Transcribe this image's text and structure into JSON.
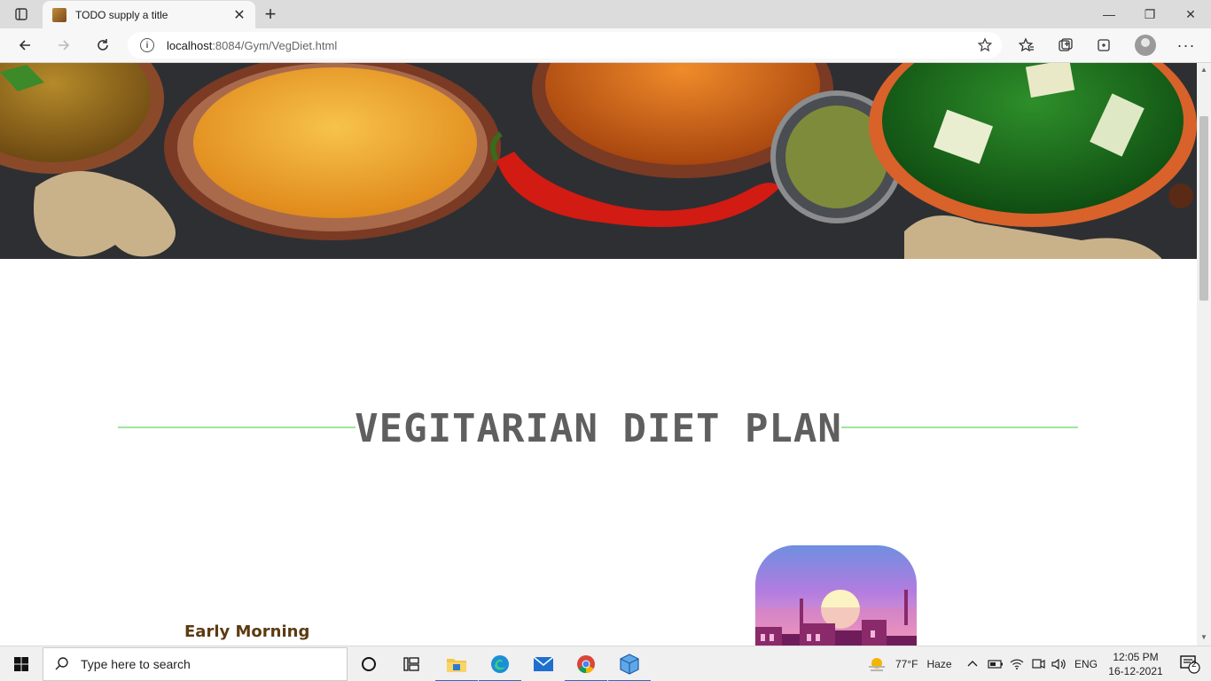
{
  "browser": {
    "tab_title": "TODO supply a title",
    "tab_close_glyph": "✕",
    "new_tab_glyph": "+",
    "url_host": "localhost",
    "url_rest": ":8084/Gym/VegDiet.html",
    "window_minimize": "—",
    "window_restore": "❐",
    "window_close": "✕"
  },
  "page": {
    "heading": "VEGITARIAN DIET PLAN",
    "section_label": "Early Morning",
    "colors": {
      "heading_text": "#5f5f5f",
      "heading_rule": "#9be69b",
      "section_label": "#5c3b12"
    }
  },
  "taskbar": {
    "search_placeholder": "Type here to search",
    "weather_temp": "77°F",
    "weather_condition": "Haze",
    "language": "ENG",
    "time": "12:05 PM",
    "date": "16-12-2021",
    "notification_count": "2"
  },
  "icons": [
    "tab-actions-icon",
    "back-arrow-icon",
    "forward-arrow-icon",
    "refresh-icon",
    "info-icon",
    "add-favorite-icon",
    "favorites-icon",
    "collections-icon",
    "extensions-icon",
    "profile-icon",
    "more-menu-icon",
    "windows-start-icon",
    "search-icon",
    "task-view-icon",
    "widgets-icon",
    "file-explorer-icon",
    "edge-icon",
    "mail-icon",
    "chrome-icon",
    "box-app-icon",
    "weather-icon",
    "chevron-up-icon",
    "battery-icon",
    "wifi-icon",
    "meet-now-icon",
    "volume-icon",
    "notifications-icon"
  ]
}
